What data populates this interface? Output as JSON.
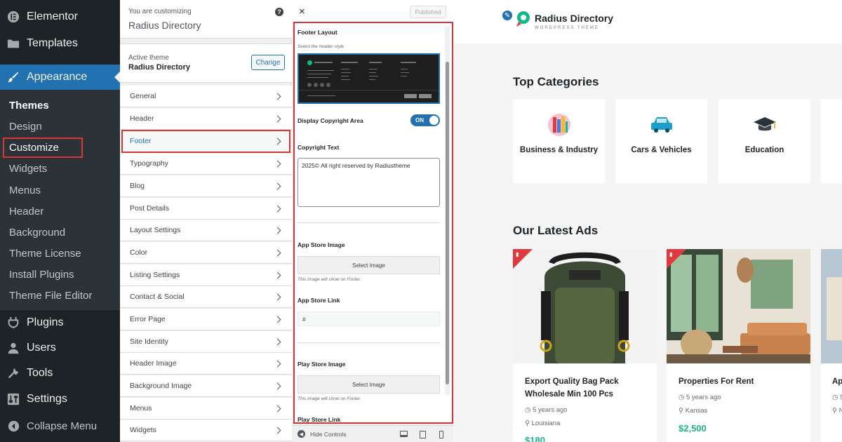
{
  "wp_menu": {
    "elementor": "Elementor",
    "templates": "Templates",
    "appearance": "Appearance",
    "sub": [
      "Themes",
      "Design",
      "Customize",
      "Widgets",
      "Menus",
      "Header",
      "Background",
      "Theme License",
      "Install Plugins",
      "Theme File Editor"
    ],
    "plugins": "Plugins",
    "users": "Users",
    "tools": "Tools",
    "settings": "Settings",
    "collapse": "Collapse Menu"
  },
  "customizer": {
    "customizing_label": "You are customizing",
    "site_name": "Radius Directory",
    "active_theme_label": "Active theme",
    "active_theme": "Radius Directory",
    "change_label": "Change",
    "sections": [
      "General",
      "Header",
      "Footer",
      "Typography",
      "Blog",
      "Post Details",
      "Layout Settings",
      "Color",
      "Listing Settings",
      "Contact & Social",
      "Error Page",
      "Site Identity",
      "Header Image",
      "Background Image",
      "Menus",
      "Widgets"
    ]
  },
  "footer_panel": {
    "close": "×",
    "published": "Published",
    "footer_layout": "Footer Layout",
    "header_style_hint": "Select the header style",
    "display_copyright": "Display Copyright Area",
    "toggle_state": "ON",
    "copyright_label": "Copyright Text",
    "copyright_value": "2025© All right reserved by Radiustheme",
    "app_store_image": "App Store Image",
    "select_image": "Select Image",
    "image_hint": "This image will show on Footer.",
    "app_store_link": "App Store Link",
    "app_store_link_value": "#",
    "play_store_image": "Play Store Image",
    "play_store_link": "Play Store Link",
    "hide_controls": "Hide Controls"
  },
  "preview": {
    "brand_name": "Radius Directory",
    "brand_tagline": "WORDPRESS THEME",
    "top_categories": "Top Categories",
    "categories": [
      {
        "label": "Business & Industry"
      },
      {
        "label": "Cars & Vehicles"
      },
      {
        "label": "Education"
      }
    ],
    "latest_ads": "Our Latest Ads",
    "ads": [
      {
        "title": "Export Quality Bag Pack Wholesale Min 100 Pcs",
        "time": "5 years ago",
        "location": "Louisiana",
        "price": "$180"
      },
      {
        "title": "Properties For Rent",
        "time": "5 years ago",
        "location": "Kansas",
        "price": "$2,500"
      },
      {
        "title": "Ap",
        "time": "5",
        "location": "N",
        "price": ""
      }
    ]
  },
  "colors": {
    "wp_dark": "#1d2327",
    "wp_blue": "#2271b1",
    "highlight": "#d63638",
    "price": "#1bb68a"
  }
}
